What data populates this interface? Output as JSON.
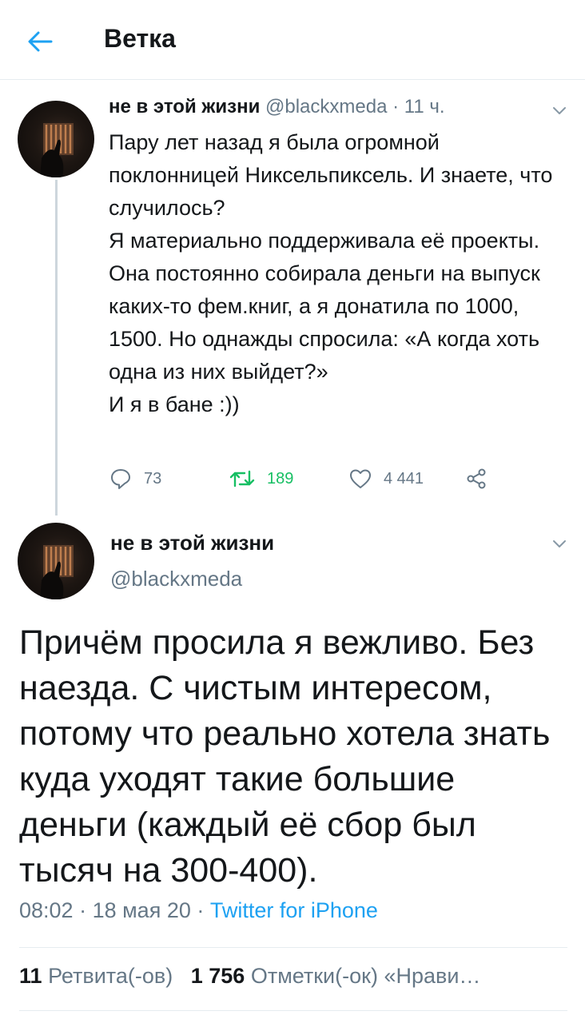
{
  "header": {
    "title": "Ветка"
  },
  "tweet1": {
    "name": "не в этой жизни",
    "handle": "@blackxmeda",
    "separator": " · ",
    "time": "11 ч.",
    "lines": [
      "Пару лет назад я была огромной поклонницей Никсельпиксель. И знаете, что случилось?",
      "Я материально поддерживала её проекты. Она постоянно собирала деньги на выпуск каких-то фем.книг, а я донатила по 1000, 1500. Но однажды спросила: «А когда хоть одна из них выйдет?»",
      "И я в бане :))"
    ],
    "replies": "73",
    "retweets": "189",
    "likes": "4 441"
  },
  "tweet2": {
    "name": "не в этой жизни",
    "handle": "@blackxmeda",
    "text": "Причём просила я вежливо. Без наезда. С чистым интересом, потому что реально хотела знать куда уходят такие большие деньги (каждый её сбор был тысяч на 300-400).",
    "time": "08:02",
    "date": "18 мая 20",
    "separator": " · ",
    "source": "Twitter for iPhone",
    "retweet_count": "11",
    "retweet_label": "Ретвита(-ов)",
    "like_count": "1 756",
    "like_label": "Отметки(-ок) «Нрави…"
  },
  "colors": {
    "accent": "#1da1f2",
    "retweet": "#17bf63",
    "muted": "#657786",
    "text": "#14171a"
  },
  "icons": [
    "back-arrow-icon",
    "chevron-down-icon",
    "reply-icon",
    "retweet-icon",
    "like-icon",
    "share-icon"
  ]
}
